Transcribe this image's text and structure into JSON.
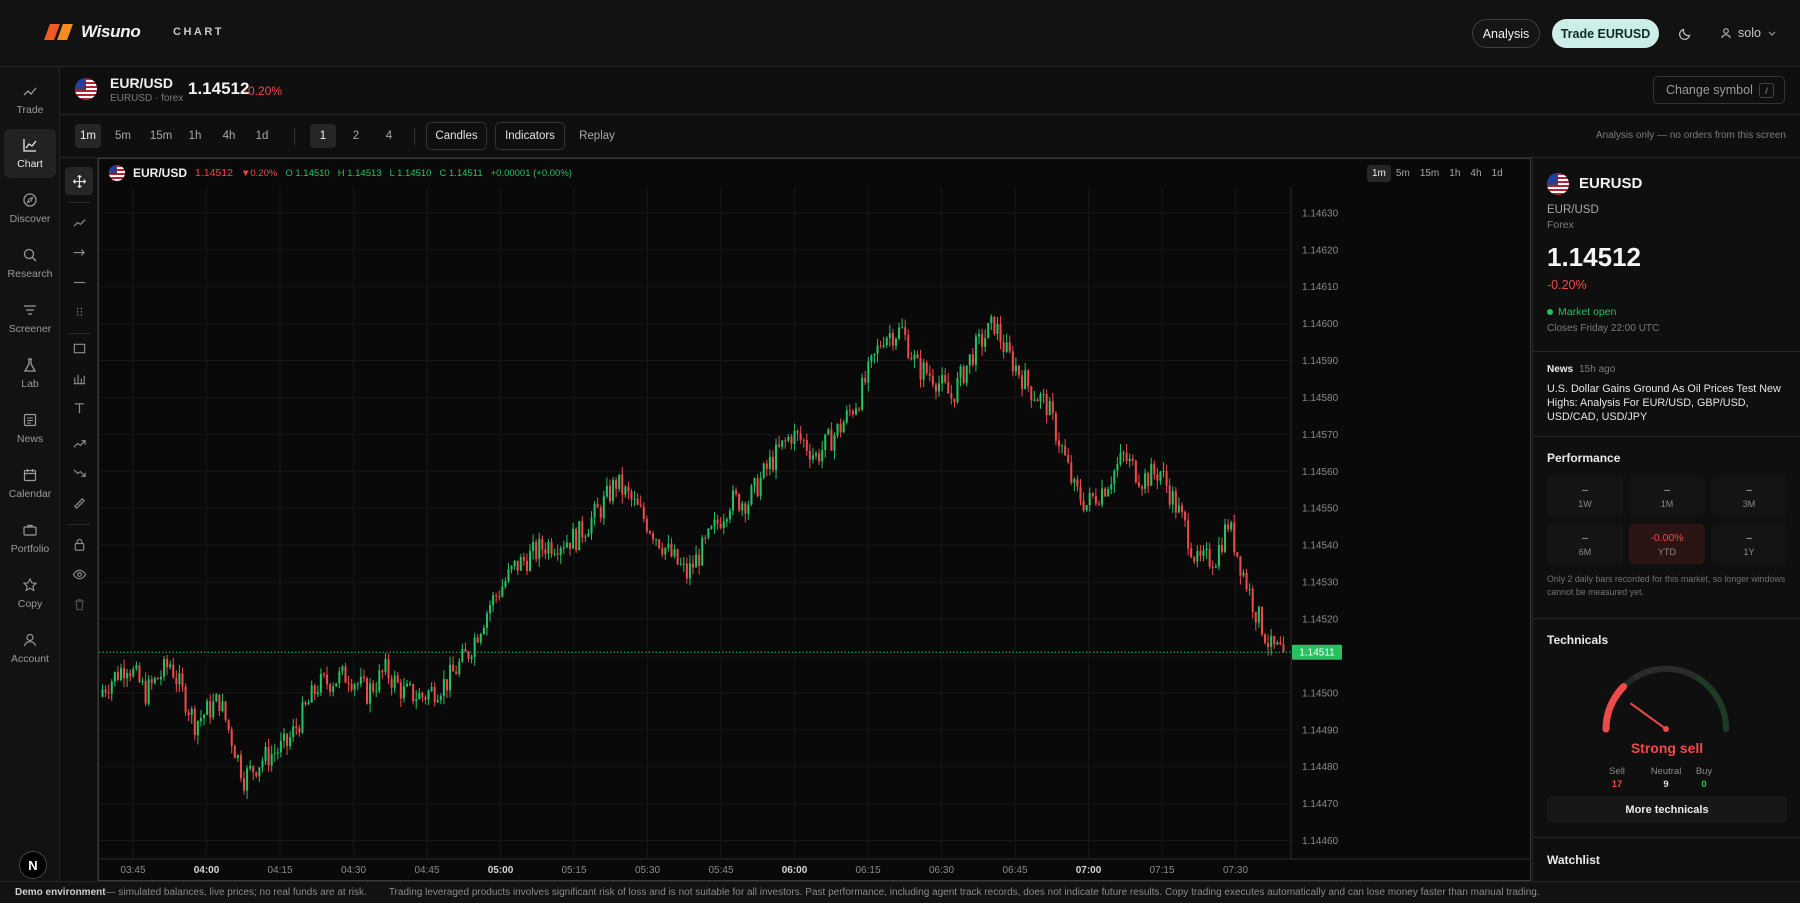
{
  "header": {
    "brand": "Wisuno",
    "section": "CHART",
    "analysis_label": "Analysis",
    "trade_label": "Trade EURUSD",
    "user_name": "solo"
  },
  "nav": {
    "items": [
      {
        "label": "Trade",
        "icon": "trend-up-icon"
      },
      {
        "label": "Chart",
        "icon": "chart-icon",
        "active": true
      },
      {
        "label": "Discover",
        "icon": "compass-icon"
      },
      {
        "label": "Research",
        "icon": "magnify-icon"
      },
      {
        "label": "Screener",
        "icon": "filter-icon"
      },
      {
        "label": "Lab",
        "icon": "flask-icon"
      },
      {
        "label": "News",
        "icon": "newspaper-icon"
      },
      {
        "label": "Calendar",
        "icon": "calendar-icon"
      },
      {
        "label": "Portfolio",
        "icon": "briefcase-icon"
      },
      {
        "label": "Copy",
        "icon": "star-icon"
      },
      {
        "label": "Account",
        "icon": "user-icon"
      }
    ],
    "badge": "N"
  },
  "symbol": {
    "name": "EUR/USD",
    "sub": "EURUSD · forex",
    "price": "1.14512",
    "change": "-0.20%",
    "change_symbol_label": "Change symbol",
    "shortcut": "/"
  },
  "toolbar": {
    "timeframes": [
      "1m",
      "5m",
      "15m",
      "1h",
      "4h",
      "1d"
    ],
    "active_timeframe": "1m",
    "layouts": [
      "1",
      "2",
      "4"
    ],
    "active_layout": "1",
    "candles_label": "Candles",
    "indicators_label": "Indicators",
    "replay_label": "Replay",
    "note": "Analysis only — no orders from this screen"
  },
  "legend": {
    "symbol": "EUR/USD",
    "price": "1.14512",
    "change": "▼0.20%",
    "o": "O 1.14510",
    "h": "H 1.14513",
    "l": "L 1.14510",
    "c": "C 1.14511",
    "delta": "+0.00001 (+0.00%)",
    "timeframes": [
      "1m",
      "5m",
      "15m",
      "1h",
      "4h",
      "1d"
    ]
  },
  "chart_data": {
    "type": "candlestick",
    "x_ticks": [
      "03:45",
      "04:00",
      "04:15",
      "04:30",
      "04:45",
      "05:00",
      "05:15",
      "05:30",
      "05:45",
      "06:00",
      "06:15",
      "06:30",
      "06:45",
      "07:00",
      "07:15",
      "07:30"
    ],
    "bold_ticks": [
      "04:00",
      "05:00",
      "06:00",
      "07:00"
    ],
    "y_ticks": [
      "1.14630",
      "1.14620",
      "1.14610",
      "1.14600",
      "1.14590",
      "1.14580",
      "1.14570",
      "1.14560",
      "1.14550",
      "1.14540",
      "1.14530",
      "1.14520",
      "1.14510",
      "1.14500",
      "1.14490",
      "1.14480",
      "1.14470",
      "1.14460"
    ],
    "ylim": [
      1.14455,
      1.14637
    ],
    "last_price_label": "1.14511",
    "last_price": 1.14511,
    "colors": {
      "up": "#26c261",
      "down": "#ef4a4a"
    },
    "close_path": [
      [
        0,
        1.14501
      ],
      [
        8,
        1.14508
      ],
      [
        14,
        1.145
      ],
      [
        22,
        1.14508
      ],
      [
        30,
        1.14492
      ],
      [
        38,
        1.14498
      ],
      [
        46,
        1.14477
      ],
      [
        52,
        1.14482
      ],
      [
        60,
        1.14486
      ],
      [
        70,
        1.14502
      ],
      [
        80,
        1.14505
      ],
      [
        86,
        1.145
      ],
      [
        92,
        1.14506
      ],
      [
        98,
        1.145
      ],
      [
        104,
        1.14499
      ],
      [
        112,
        1.14503
      ],
      [
        119,
        1.14511
      ],
      [
        126,
        1.14524
      ],
      [
        134,
        1.14534
      ],
      [
        144,
        1.1454
      ],
      [
        154,
        1.14542
      ],
      [
        162,
        1.1455
      ],
      [
        167,
        1.14557
      ],
      [
        172,
        1.14552
      ],
      [
        178,
        1.14545
      ],
      [
        184,
        1.14538
      ],
      [
        190,
        1.14532
      ],
      [
        196,
        1.1454
      ],
      [
        204,
        1.14552
      ],
      [
        210,
        1.14552
      ],
      [
        217,
        1.14562
      ],
      [
        224,
        1.1457
      ],
      [
        228,
        1.14568
      ],
      [
        232,
        1.14564
      ],
      [
        240,
        1.14572
      ],
      [
        246,
        1.1458
      ],
      [
        254,
        1.14597
      ],
      [
        260,
        1.14598
      ],
      [
        265,
        1.14588
      ],
      [
        270,
        1.14586
      ],
      [
        276,
        1.1458
      ],
      [
        283,
        1.14592
      ],
      [
        290,
        1.146
      ],
      [
        294,
        1.14592
      ],
      [
        302,
        1.14582
      ],
      [
        307,
        1.14578
      ],
      [
        312,
        1.14566
      ],
      [
        316,
        1.14555
      ],
      [
        320,
        1.14551
      ],
      [
        326,
        1.14556
      ],
      [
        332,
        1.14564
      ],
      [
        338,
        1.14558
      ],
      [
        344,
        1.1456
      ],
      [
        352,
        1.14545
      ],
      [
        356,
        1.14535
      ],
      [
        362,
        1.14537
      ],
      [
        366,
        1.14546
      ],
      [
        370,
        1.14535
      ],
      [
        375,
        1.14522
      ],
      [
        380,
        1.14512
      ],
      [
        384,
        1.14511
      ]
    ]
  },
  "panel": {
    "symbol": "EURUSD",
    "pair": "EUR/USD",
    "asset_class": "Forex",
    "price": "1.14512",
    "change": "-0.20%",
    "market_status": "Market open",
    "closes": "Closes Friday 22:00 UTC",
    "news_label": "News",
    "news_age": "15h ago",
    "news_headline": "U.S. Dollar Gains Ground As Oil Prices Test New Highs: Analysis For EUR/USD, GBP/USD, USD/CAD, USD/JPY",
    "performance_label": "Performance",
    "performance": [
      {
        "period": "1W",
        "value": "–"
      },
      {
        "period": "1M",
        "value": "–"
      },
      {
        "period": "3M",
        "value": "–"
      },
      {
        "period": "6M",
        "value": "–"
      },
      {
        "period": "YTD",
        "value": "-0.00%",
        "negative": true
      },
      {
        "period": "1Y",
        "value": "–"
      }
    ],
    "performance_note": "Only 2 daily bars recorded for this market, so longer windows cannot be measured yet.",
    "technicals_label": "Technicals",
    "technicals_rating": "Strong sell",
    "technicals_position": 0.2,
    "sell_label": "Sell",
    "sell_count": "17",
    "neutral_label": "Neutral",
    "neutral_count": "9",
    "buy_label": "Buy",
    "buy_count": "0",
    "more_technicals": "More technicals",
    "watchlist_label": "Watchlist"
  },
  "footer": {
    "env_label": "Demo environment",
    "env_text": " — simulated balances, live prices; no real funds are at risk.",
    "disclaimer": "Trading leveraged products involves significant risk of loss and is not suitable for all investors. Past performance, including agent track records, does not indicate future results. Copy trading executes automatically and can lose money faster than manual trading."
  }
}
